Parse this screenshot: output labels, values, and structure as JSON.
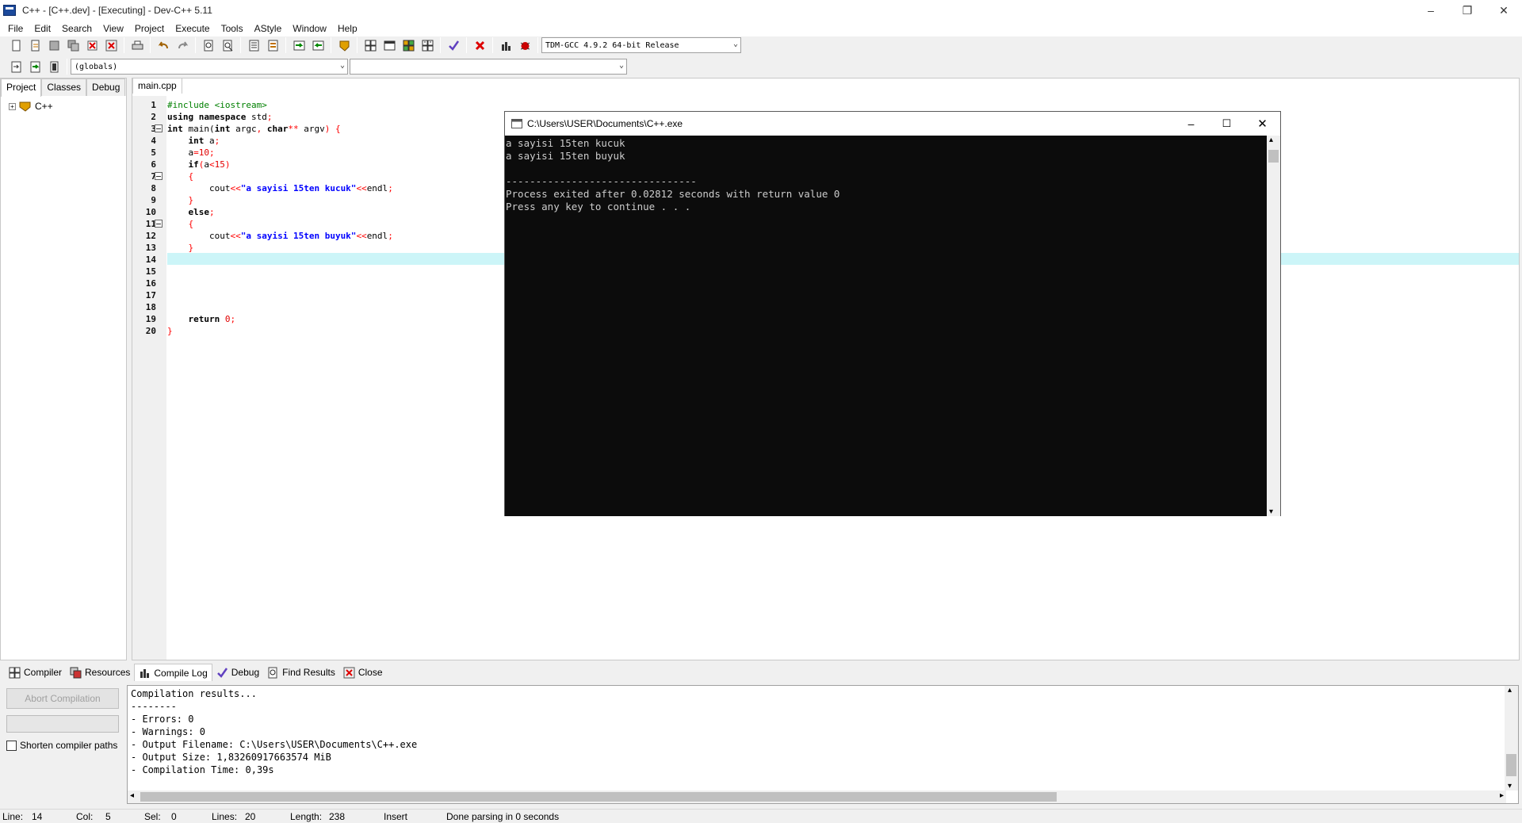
{
  "window": {
    "title": "C++ - [C++.dev] - [Executing] - Dev-C++ 5.11"
  },
  "menu": [
    "File",
    "Edit",
    "Search",
    "View",
    "Project",
    "Execute",
    "Tools",
    "AStyle",
    "Window",
    "Help"
  ],
  "toolbar": {
    "compiler_select": "TDM-GCC 4.9.2 64-bit Release",
    "scope_select": "(globals)",
    "member_select": ""
  },
  "left_panel": {
    "tabs": [
      "Project",
      "Classes",
      "Debug"
    ],
    "tree_root": "C++"
  },
  "editor": {
    "tab": "main.cpp",
    "lines": [
      [
        [
          "pp",
          "#include <iostream>"
        ]
      ],
      [
        [
          "kw",
          "using namespace"
        ],
        [
          "t",
          " std"
        ],
        [
          "sym",
          ";"
        ]
      ],
      [
        [
          "kw",
          "int"
        ],
        [
          "t",
          " main("
        ],
        [
          "kw",
          "int"
        ],
        [
          "t",
          " argc"
        ],
        [
          "sym",
          ","
        ],
        [
          "t",
          " "
        ],
        [
          "kw",
          "char"
        ],
        [
          "sym",
          "**"
        ],
        [
          "t",
          " argv"
        ],
        [
          "sym",
          ")"
        ],
        [
          "t",
          " "
        ],
        [
          "sym",
          "{"
        ]
      ],
      [
        [
          "t",
          "    "
        ],
        [
          "kw",
          "int"
        ],
        [
          "t",
          " a"
        ],
        [
          "sym",
          ";"
        ]
      ],
      [
        [
          "t",
          "    a"
        ],
        [
          "sym",
          "="
        ],
        [
          "num",
          "10"
        ],
        [
          "sym",
          ";"
        ]
      ],
      [
        [
          "t",
          "    "
        ],
        [
          "kw",
          "if"
        ],
        [
          "sym",
          "("
        ],
        [
          "t",
          "a"
        ],
        [
          "sym",
          "<"
        ],
        [
          "num",
          "15"
        ],
        [
          "sym",
          ")"
        ]
      ],
      [
        [
          "t",
          "    "
        ],
        [
          "sym",
          "{"
        ]
      ],
      [
        [
          "t",
          "        cout"
        ],
        [
          "sym",
          "<<"
        ],
        [
          "str",
          "\"a sayisi 15ten kucuk\""
        ],
        [
          "sym",
          "<<"
        ],
        [
          "t",
          "endl"
        ],
        [
          "sym",
          ";"
        ]
      ],
      [
        [
          "t",
          "    "
        ],
        [
          "sym",
          "}"
        ]
      ],
      [
        [
          "t",
          "    "
        ],
        [
          "kw",
          "else"
        ],
        [
          "sym",
          ";"
        ]
      ],
      [
        [
          "t",
          "    "
        ],
        [
          "sym",
          "{"
        ]
      ],
      [
        [
          "t",
          "        cout"
        ],
        [
          "sym",
          "<<"
        ],
        [
          "str",
          "\"a sayisi 15ten buyuk\""
        ],
        [
          "sym",
          "<<"
        ],
        [
          "t",
          "endl"
        ],
        [
          "sym",
          ";"
        ]
      ],
      [
        [
          "t",
          "    "
        ],
        [
          "sym",
          "}"
        ]
      ],
      [
        [
          "t",
          ""
        ]
      ],
      [
        [
          "t",
          ""
        ]
      ],
      [
        [
          "t",
          ""
        ]
      ],
      [
        [
          "t",
          ""
        ]
      ],
      [
        [
          "t",
          ""
        ]
      ],
      [
        [
          "t",
          "    "
        ],
        [
          "kw",
          "return"
        ],
        [
          "t",
          " "
        ],
        [
          "num",
          "0"
        ],
        [
          "sym",
          ";"
        ]
      ],
      [
        [
          "sym",
          "}"
        ]
      ]
    ]
  },
  "console": {
    "title": "C:\\Users\\USER\\Documents\\C++.exe",
    "output": "a sayisi 15ten kucuk\na sayisi 15ten buyuk\n\n--------------------------------\nProcess exited after 0.02812 seconds with return value 0\nPress any key to continue . . ."
  },
  "bottom": {
    "tabs": [
      "Compiler",
      "Resources",
      "Compile Log",
      "Debug",
      "Find Results",
      "Close"
    ],
    "abort_label": "Abort Compilation",
    "shorten_label": "Shorten compiler paths",
    "log": "Compilation results...\n--------\n- Errors: 0\n- Warnings: 0\n- Output Filename: C:\\Users\\USER\\Documents\\C++.exe\n- Output Size: 1,83260917663574 MiB\n- Compilation Time: 0,39s"
  },
  "status": {
    "line_label": "Line:",
    "line": "14",
    "col_label": "Col:",
    "col": "5",
    "sel_label": "Sel:",
    "sel": "0",
    "lines_label": "Lines:",
    "lines": "20",
    "length_label": "Length:",
    "length": "238",
    "mode": "Insert",
    "message": "Done parsing in 0 seconds"
  }
}
